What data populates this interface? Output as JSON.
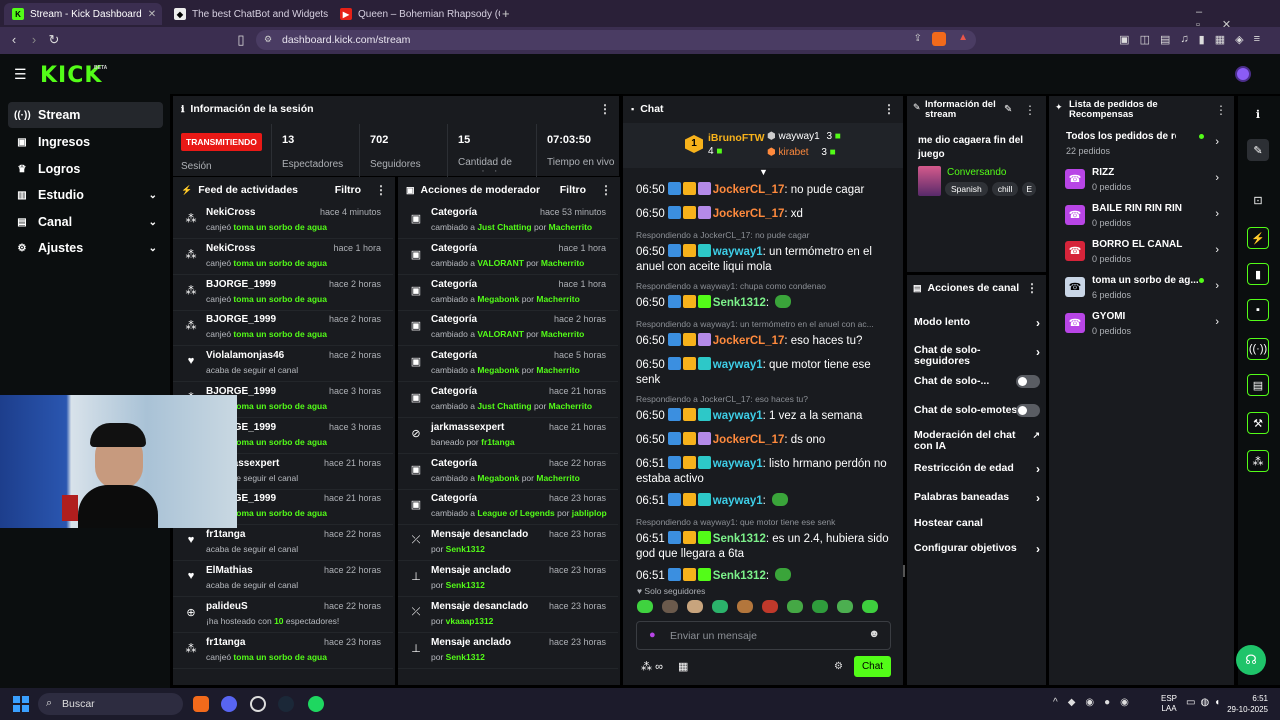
{
  "browser": {
    "tabs": [
      {
        "title": "Stream - Kick Dashboard",
        "active": true
      },
      {
        "title": "The best ChatBot and Widgets for Ki"
      },
      {
        "title": "Queen – Bohemian Rhapsody (Officia"
      }
    ],
    "url": "dashboard.kick.com/stream"
  },
  "header": {
    "logo": "KICK",
    "beta": "BETA"
  },
  "sidebar": {
    "items": [
      {
        "label": "Stream",
        "icon": "stream-icon"
      },
      {
        "label": "Ingresos",
        "icon": "money-icon"
      },
      {
        "label": "Logros",
        "icon": "trophy-icon"
      },
      {
        "label": "Estudio",
        "icon": "studio-icon",
        "chevron": true
      },
      {
        "label": "Canal",
        "icon": "channel-icon",
        "chevron": true
      },
      {
        "label": "Ajustes",
        "icon": "gear-icon",
        "chevron": true
      }
    ]
  },
  "session": {
    "title": "Información de la sesión",
    "badge": "TRANSMITIENDO",
    "badge_label": "Sesión",
    "stats": [
      {
        "value": "13",
        "label": "Espectadores"
      },
      {
        "value": "702",
        "label": "Seguidores"
      },
      {
        "value": "15",
        "label": "Cantidad de suscripciones"
      },
      {
        "value": "07:03:50",
        "label": "Tiempo en vivo"
      }
    ]
  },
  "feed": {
    "title": "Feed de actividades",
    "filter": "Filtro",
    "rows": [
      {
        "name": "NekiCross",
        "time": "hace 4 minutos",
        "pre": "canjeó ",
        "hl": "toma un sorbo de agua",
        "post": "",
        "icon": "redeem-icon"
      },
      {
        "name": "NekiCross",
        "time": "hace 1 hora",
        "pre": "canjeó ",
        "hl": "toma un sorbo de agua",
        "post": "",
        "icon": "redeem-icon"
      },
      {
        "name": "BJORGE_1999",
        "time": "hace 2 horas",
        "pre": "canjeó ",
        "hl": "toma un sorbo de agua",
        "post": "",
        "icon": "redeem-icon"
      },
      {
        "name": "BJORGE_1999",
        "time": "hace 2 horas",
        "pre": "canjeó ",
        "hl": "toma un sorbo de agua",
        "post": "",
        "icon": "redeem-icon"
      },
      {
        "name": "Violalamonjas46",
        "time": "hace 2 horas",
        "pre": "acaba de seguir el canal",
        "hl": "",
        "post": "",
        "icon": "heart-icon"
      },
      {
        "name": "BJORGE_1999",
        "time": "hace 3 horas",
        "pre": "canjeó ",
        "hl": "toma un sorbo de agua",
        "post": "",
        "icon": "redeem-icon"
      },
      {
        "name": "BJORGE_1999",
        "time": "hace 3 horas",
        "pre": "canjeó ",
        "hl": "toma un sorbo de agua",
        "post": "",
        "icon": "redeem-icon"
      },
      {
        "name": "jarkmassexpert",
        "time": "hace 21 horas",
        "pre": "acaba de seguir el canal",
        "hl": "",
        "post": "",
        "icon": "heart-icon"
      },
      {
        "name": "BJORGE_1999",
        "time": "hace 21 horas",
        "pre": "canjeó ",
        "hl": "toma un sorbo de agua",
        "post": "",
        "icon": "redeem-icon"
      },
      {
        "name": "fr1tanga",
        "time": "hace 22 horas",
        "pre": "acaba de seguir el canal",
        "hl": "",
        "post": "",
        "icon": "heart-icon"
      },
      {
        "name": "ElMathias",
        "time": "hace 22 horas",
        "pre": "acaba de seguir el canal",
        "hl": "",
        "post": "",
        "icon": "heart-icon"
      },
      {
        "name": "palideuS",
        "time": "hace 22 horas",
        "pre": "¡ha hosteado con ",
        "hl": "10",
        "post": " espectadores!",
        "icon": "host-icon"
      },
      {
        "name": "fr1tanga",
        "time": "hace 23 horas",
        "pre": "canjeó ",
        "hl": "toma un sorbo de agua",
        "post": "",
        "icon": "redeem-icon"
      }
    ]
  },
  "modactions": {
    "title": "Acciones de moderador",
    "filter": "Filtro",
    "rows": [
      {
        "name": "Categoría",
        "time": "hace 53 minutos",
        "pre": "cambiado a ",
        "hl": "Just Chatting",
        "mid": " por ",
        "by": "Macherrito",
        "icon": "category-icon"
      },
      {
        "name": "Categoría",
        "time": "hace 1 hora",
        "pre": "cambiado a ",
        "hl": "VALORANT",
        "mid": " por ",
        "by": "Macherrito",
        "icon": "category-icon"
      },
      {
        "name": "Categoría",
        "time": "hace 1 hora",
        "pre": "cambiado a ",
        "hl": "Megabonk",
        "mid": " por ",
        "by": "Macherrito",
        "icon": "category-icon"
      },
      {
        "name": "Categoría",
        "time": "hace 2 horas",
        "pre": "cambiado a ",
        "hl": "VALORANT",
        "mid": " por ",
        "by": "Macherrito",
        "icon": "category-icon"
      },
      {
        "name": "Categoría",
        "time": "hace 5 horas",
        "pre": "cambiado a ",
        "hl": "Megabonk",
        "mid": " por ",
        "by": "Macherrito",
        "icon": "category-icon"
      },
      {
        "name": "Categoría",
        "time": "hace 21 horas",
        "pre": "cambiado a ",
        "hl": "Just Chatting",
        "mid": " por ",
        "by": "Macherrito",
        "icon": "category-icon"
      },
      {
        "name": "jarkmassexpert",
        "time": "hace 21 horas",
        "pre": "baneado por ",
        "hl": "",
        "mid": "",
        "by": "fr1tanga",
        "icon": "ban-icon"
      },
      {
        "name": "Categoría",
        "time": "hace 22 horas",
        "pre": "cambiado a ",
        "hl": "Megabonk",
        "mid": " por ",
        "by": "Macherrito",
        "icon": "category-icon"
      },
      {
        "name": "Categoría",
        "time": "hace 23 horas",
        "pre": "cambiado a ",
        "hl": "League of Legends",
        "mid": " por ",
        "by": "jabliplop",
        "icon": "category-icon"
      },
      {
        "name": "Mensaje desanclado",
        "time": "hace 23 horas",
        "pre": "por ",
        "hl": "",
        "mid": "",
        "by": "Senk1312",
        "icon": "unpin-icon"
      },
      {
        "name": "Mensaje anclado",
        "time": "hace 23 horas",
        "pre": "por ",
        "hl": "",
        "mid": "",
        "by": "Senk1312",
        "icon": "pin-icon"
      },
      {
        "name": "Mensaje desanclado",
        "time": "hace 23 horas",
        "pre": "por ",
        "hl": "",
        "mid": "",
        "by": "vkaaap1312",
        "icon": "unpin-icon"
      },
      {
        "name": "Mensaje anclado",
        "time": "hace 23 horas",
        "pre": "por ",
        "hl": "",
        "mid": "",
        "by": "Senk1312",
        "icon": "pin-icon"
      }
    ]
  },
  "chat": {
    "title": "Chat",
    "leaderboard": [
      {
        "rank": "1",
        "name": "iBrunoFTW",
        "count": "4"
      },
      {
        "name": "wayway1",
        "count": "3"
      },
      {
        "name": "kirabet",
        "count": "3"
      }
    ],
    "messages": [
      {
        "time": "06:50",
        "user": "JockerCL_17",
        "color": "#ff8a3d",
        "text": "no pude cagar"
      },
      {
        "time": "06:50",
        "user": "JockerCL_17",
        "color": "#ff8a3d",
        "text": "xd"
      },
      {
        "reply": "Respondiendo a JockerCL_17: no pude cagar",
        "time": "06:50",
        "user": "wayway1",
        "color": "#3ecfe8",
        "text": "un termómetro en el anuel con aceite liqui mola"
      },
      {
        "reply": "Respondiendo a wayway1: chupa como condenao",
        "time": "06:50",
        "user": "Senk1312",
        "color": "#7cf08a",
        "text": ""
      },
      {
        "reply": "Respondiendo a wayway1: un termómetro en el anuel con ac...",
        "time": "06:50",
        "user": "JockerCL_17",
        "color": "#ff8a3d",
        "text": "eso haces tu?"
      },
      {
        "time": "06:50",
        "user": "wayway1",
        "color": "#3ecfe8",
        "text": "que motor tiene ese senk"
      },
      {
        "reply": "Respondiendo a JockerCL_17: eso haces tu?",
        "time": "06:50",
        "user": "wayway1",
        "color": "#3ecfe8",
        "text": "1 vez a la semana"
      },
      {
        "time": "06:50",
        "user": "JockerCL_17",
        "color": "#ff8a3d",
        "text": "ds ono"
      },
      {
        "time": "06:51",
        "user": "wayway1",
        "color": "#3ecfe8",
        "text": "listo hrmano perdón no estaba activo"
      },
      {
        "time": "06:51",
        "user": "wayway1",
        "color": "#3ecfe8",
        "text": ""
      },
      {
        "reply": "Respondiendo a wayway1: que motor tiene ese senk",
        "time": "06:51",
        "user": "Senk1312",
        "color": "#7cf08a",
        "text": "es un 2.4, hubiera sido god que llegara a 6ta"
      },
      {
        "time": "06:51",
        "user": "Senk1312",
        "color": "#7cf08a",
        "text": ""
      }
    ],
    "followers_only": "Solo seguidores",
    "input_placeholder": "Enviar un mensaje",
    "send": "Chat"
  },
  "streaminfo": {
    "title": "Información del stream",
    "stream_title": "me dio cagaera fin del juego",
    "category": "Conversando",
    "tags": [
      "Spanish",
      "chill",
      "E"
    ]
  },
  "channelactions": {
    "title": "Acciones de canal",
    "rows": [
      {
        "label": "Modo lento",
        "kind": "chevron"
      },
      {
        "label": "Chat de solo-seguidores",
        "kind": "chevron"
      },
      {
        "label": "Chat de solo-...",
        "kind": "toggle"
      },
      {
        "label": "Chat de solo-emotes",
        "kind": "toggle"
      },
      {
        "label": "Moderación del chat con IA",
        "kind": "external"
      },
      {
        "label": "Restricción de edad",
        "kind": "chevron"
      },
      {
        "label": "Palabras baneadas",
        "kind": "chevron"
      },
      {
        "label": "Hostear canal",
        "kind": "none"
      },
      {
        "label": "Configurar objetivos",
        "kind": "chevron"
      }
    ]
  },
  "rewards": {
    "title": "Lista de pedidos de Recompensas",
    "rows": [
      {
        "name": "Todos los pedidos de reco...",
        "count": "22 pedidos",
        "color": "",
        "dot": true
      },
      {
        "name": "RIZZ",
        "count": "0 pedidos",
        "color": "#b845e6"
      },
      {
        "name": "BAILE RIN RIN RIN",
        "count": "0 pedidos",
        "color": "#b845e6"
      },
      {
        "name": "BORRO EL CANAL",
        "count": "0 pedidos",
        "color": "#d6243a"
      },
      {
        "name": "toma un sorbo de ag...",
        "count": "6 pedidos",
        "color": "#c9d6e6",
        "dot": true
      },
      {
        "name": "GYOMI",
        "count": "0 pedidos",
        "color": "#b845e6"
      }
    ]
  },
  "taskbar": {
    "search": "Buscar",
    "lang1": "ESP",
    "lang2": "LAA",
    "time": "6:51",
    "date": "29-10-2025"
  },
  "colors": {
    "accent": "#53fc18",
    "live": "#e91916",
    "panel": "#191b1f"
  }
}
